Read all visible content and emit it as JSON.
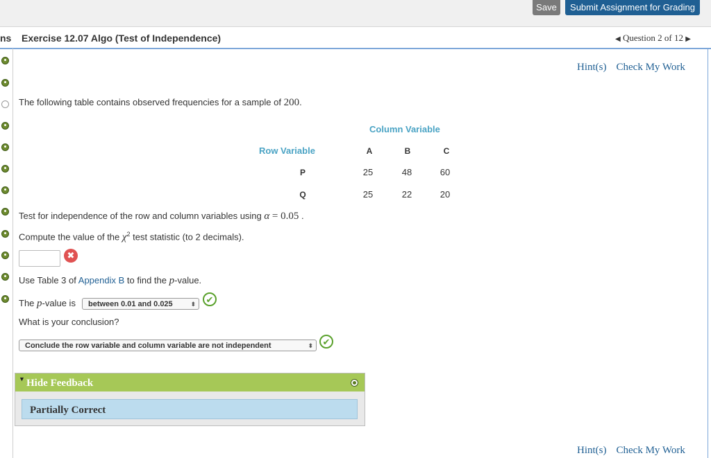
{
  "topbar": {
    "save_label": "Save",
    "submit_label": "Submit Assignment for Grading"
  },
  "header": {
    "prefix": "ns",
    "title": "Exercise 12.07 Algo (Test of Independence)",
    "question_nav": "Question 2 of 12"
  },
  "links": {
    "hints": "Hint(s)",
    "check": "Check My Work"
  },
  "question": {
    "intro_text": "The following table contains observed frequencies for a sample of",
    "sample_size": "200",
    "intro_end": ".",
    "table": {
      "column_variable": "Column Variable",
      "row_variable": "Row Variable",
      "columns": [
        "A",
        "B",
        "C"
      ],
      "rows": [
        {
          "label": "P",
          "values": [
            "25",
            "48",
            "60"
          ]
        },
        {
          "label": "Q",
          "values": [
            "25",
            "22",
            "20"
          ]
        }
      ]
    },
    "test_text": "Test for independence of the row and column variables using",
    "alpha_symbol": "α",
    "alpha_eq": "= 0.05",
    "test_end": ".",
    "compute_text_a": "Compute the value of the",
    "chi_symbol": "χ",
    "chi_exp": "2",
    "compute_text_b": "test statistic (to 2 decimals).",
    "statistic_value": "",
    "use_table_a": "Use Table 3 of",
    "appendix_link": "Appendix B",
    "use_table_b": "to find the",
    "p_symbol": "p",
    "use_table_c": "-value.",
    "pvalue_a": "The",
    "pvalue_b": "-value is",
    "pvalue_selected": "between 0.01 and 0.025",
    "conclusion_q": "What is your conclusion?",
    "conclusion_selected": "Conclude the row variable and column variable are not independent"
  },
  "feedback": {
    "toggle_label": "Hide Feedback",
    "result": "Partially Correct"
  },
  "icons": {
    "incorrect": "✖",
    "correct": "✔",
    "toggle": "▼",
    "prev": "◀",
    "next": "▶",
    "caret": "⬍"
  },
  "colors": {
    "accent_blue": "#1f5f93",
    "table_header": "#4aa3c4",
    "feedback_green": "#a6c857",
    "feedback_body": "#bcdcee",
    "incorrect_red": "#e05252",
    "correct_green": "#5aa12c"
  }
}
